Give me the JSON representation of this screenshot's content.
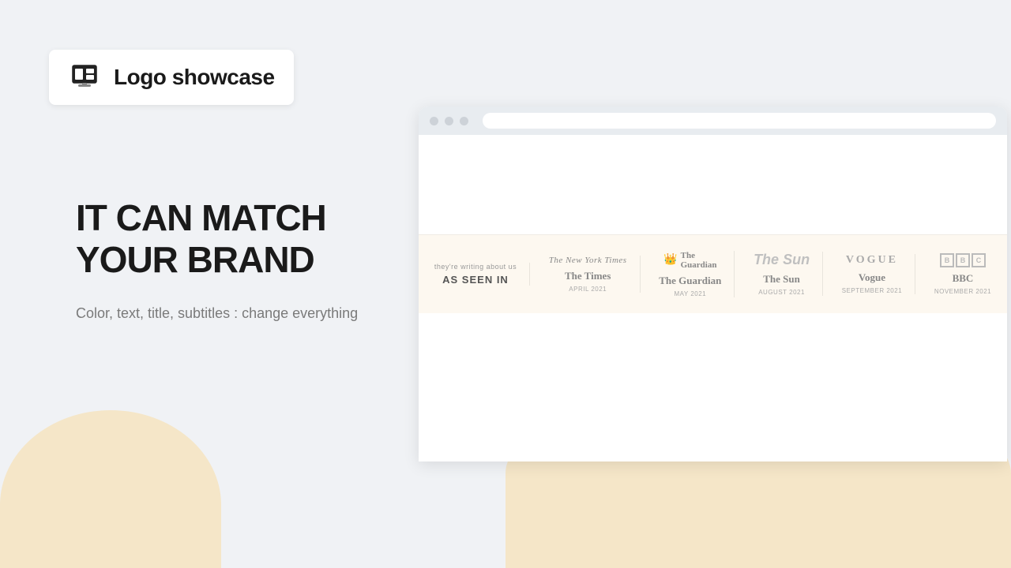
{
  "page": {
    "background_color": "#f0f2f5"
  },
  "header": {
    "badge_title": "Logo showcase",
    "badge_icon_name": "layout-icon"
  },
  "hero": {
    "heading_line1": "IT CAN MATCH",
    "heading_line2": "YOUR BRAND",
    "subtext": "Color, text, title, subtitles : change everything"
  },
  "browser": {
    "url_placeholder": "",
    "strip_label_sub": "they're writing about us",
    "strip_label_main": "AS SEEN IN",
    "logos": [
      {
        "name": "The New York Times",
        "style": "nyt",
        "logo_text": "The New York Times",
        "display_name": "The Times",
        "date": "APRIL 2021"
      },
      {
        "name": "The Guardian",
        "style": "guardian",
        "logo_text": "The Guardian",
        "display_name": "The Guardian",
        "date": "MAY 2021"
      },
      {
        "name": "The Sun",
        "style": "sun",
        "logo_text": "The Sun",
        "display_name": "The Sun",
        "date": "AUGUST 2021"
      },
      {
        "name": "Vogue",
        "style": "vogue",
        "logo_text": "VOGUE",
        "display_name": "Vogue",
        "date": "September 2021"
      },
      {
        "name": "BBC",
        "style": "bbc",
        "logo_text": "BBC",
        "display_name": "BBC",
        "date": "November 2021"
      }
    ]
  }
}
